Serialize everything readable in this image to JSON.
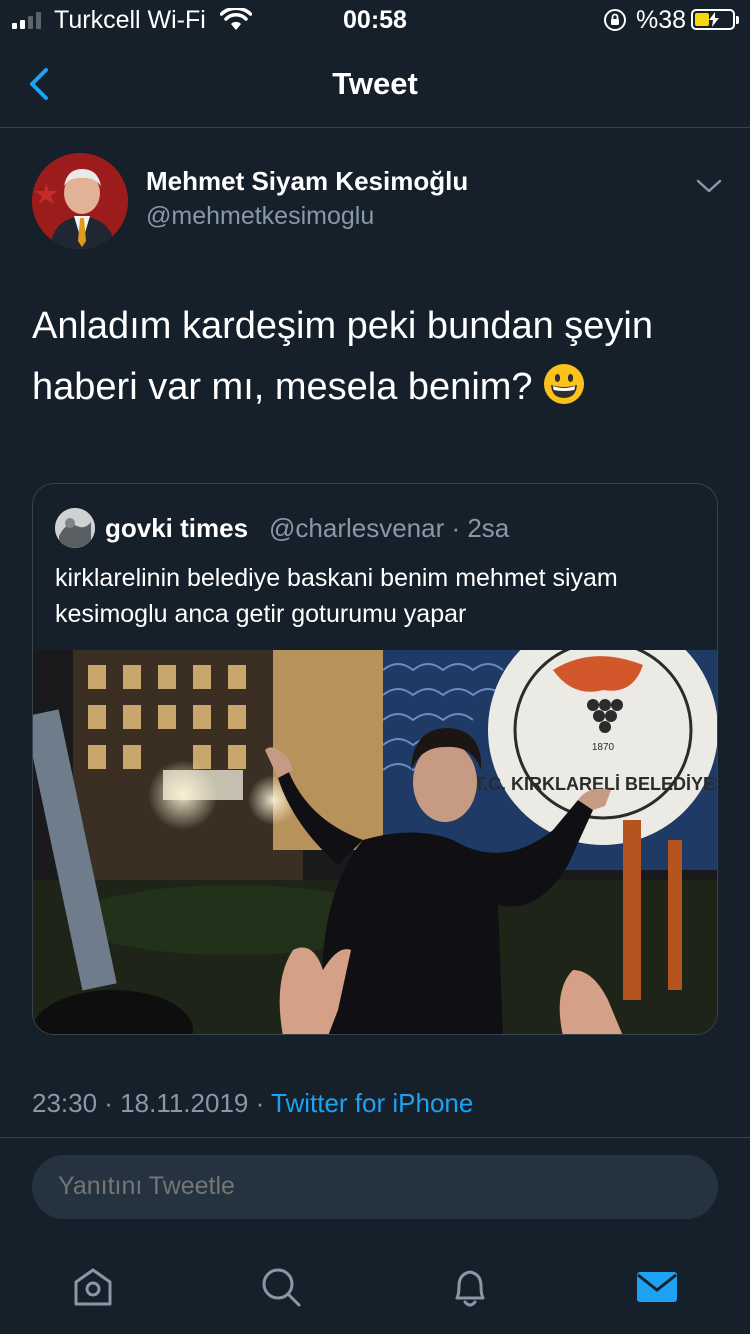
{
  "status_bar": {
    "carrier": "Turkcell Wi-Fi",
    "time": "00:58",
    "battery": "%38",
    "battery_color": "#f5d90a"
  },
  "header": {
    "title": "Tweet",
    "back_icon": "chevron-left-icon"
  },
  "tweet": {
    "author_name": "Mehmet Siyam Kesimoğlu",
    "author_handle": "@mehmetkesimoglu",
    "text": "Anladım kardeşim peki bundan şeyin haberi var mı, mesela benim?",
    "emoji": "grinning-face-emoji",
    "time": "23:30 · 18.11.2019 · ",
    "source": "Twitter for iPhone"
  },
  "quoted_tweet": {
    "author_name": "govki times",
    "meta": "@charlesvenar · 2sa",
    "text": "kirklarelinin belediye baskani benim mehmet siyam kesimoglu anca getir goturumu yapar",
    "sign_text": "T.C. KIRKLARELİ BELEDİYESİ",
    "sign_year": "1870"
  },
  "reply": {
    "placeholder": "Yanıtını Tweetle"
  },
  "tabbar": {
    "items": [
      "home-icon",
      "search-icon",
      "notifications-icon",
      "messages-icon"
    ],
    "active": "messages-icon"
  },
  "colors": {
    "background": "#15202b",
    "accent": "#1da1f2",
    "secondary_text": "#8899a6",
    "border": "#38444d"
  }
}
